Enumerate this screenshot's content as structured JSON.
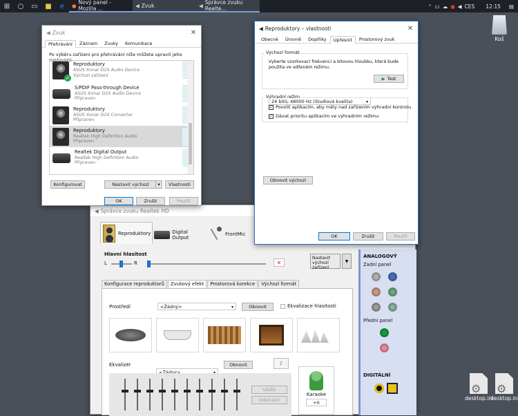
{
  "taskbar": {
    "tasks": [
      {
        "label": "Nový panel - Mozilla ..."
      },
      {
        "label": "Zvuk"
      },
      {
        "label": "Správce zvuku Realte..."
      }
    ],
    "lang": "CES",
    "clock": "12:15"
  },
  "desktop": {
    "recycle_label": "Koš",
    "file1": "desktop.ini",
    "file2": "desktop.ini"
  },
  "zvuk": {
    "title": "Zvuk",
    "tabs": [
      "Přehrávání",
      "Záznam",
      "Zvuky",
      "Komunikace"
    ],
    "instruction": "Po výběru zařízení pro přehrávání níže můžete upravit jeho nastavení:",
    "devices": [
      {
        "name": "Reproduktory",
        "sub1": "ASUS Xonar D2X Audio Device",
        "sub2": "Výchozí zařízení"
      },
      {
        "name": "S/PDIF Pass-through Device",
        "sub1": "ASUS Xonar D2X Audio Device",
        "sub2": "Připraven"
      },
      {
        "name": "Reproduktory",
        "sub1": "ASUS Xonar D2X Converter",
        "sub2": "Připraven"
      },
      {
        "name": "Reproduktory",
        "sub1": "Realtek High Definition Audio",
        "sub2": "Připraven"
      },
      {
        "name": "Realtek Digital Output",
        "sub1": "Realtek High Definition Audio",
        "sub2": "Připraven"
      }
    ],
    "configure": "Konfigurovat",
    "set_default": "Nastavit výchozí",
    "properties": "Vlastnosti",
    "ok": "OK",
    "cancel": "Zrušit",
    "apply": "Použít"
  },
  "props": {
    "title": "Reproduktory – vlastnosti",
    "tabs": [
      "Obecné",
      "Úrovně",
      "Doplňky",
      "Upřesnit",
      "Prostorový zvuk"
    ],
    "default_format_label": "Výchozí formát",
    "default_format_desc": "Vyberte vzorkovací frekvenci a bitovou hloubku, která bude použita ve sdíleném režimu.",
    "format_value": "24 bitů, 48000 Hz (Studiová kvalita)",
    "test": "Test",
    "exclusive_label": "Výhradní režim",
    "check1": "Povolit aplikacím, aby měly nad zařízením výhradní kontrolu",
    "check2": "Dávat prioritu aplikacím ve výhradním režimu",
    "restore": "Obnovit výchozí",
    "ok": "OK",
    "cancel": "Zrušit",
    "apply": "Použít"
  },
  "realtek": {
    "title": "Správce zvuku Realtek HD",
    "main_tabs": [
      "Reproduktory",
      "Digital Output",
      "FrontMic"
    ],
    "volume_label": "Hlavní hlasitost",
    "left": "L",
    "right": "R",
    "set_default_device": "Nastavit výchozí zařízení",
    "sub_tabs": [
      "Konfigurace reproduktorů",
      "Zvukový efekt",
      "Prostorová korekce",
      "Výchozí formát"
    ],
    "env_label": "Prostředí",
    "env_value": "<Žádný>",
    "reset": "Obnovit",
    "loudness": "Ekvalizace hlasitosti",
    "eq_label": "Ekvalizér",
    "eq_value": "<Žádný>",
    "eq_reset": "Obnovit",
    "save": "Uložit",
    "remove": "Odstranit",
    "karaoke": "Karaoke",
    "karaoke_value": "+0",
    "analog": "ANALOGOVÝ",
    "rear_panel": "Zadní panel",
    "front_panel": "Přední panel",
    "digital": "DIGITÁLNÍ",
    "jack_colors": [
      "#b1b1b3",
      "#4b6fb7",
      "#c99a8a",
      "#6aaa84",
      "#9c9c9c",
      "#8ab0a0",
      "#1a9c3a",
      "#e58aa0"
    ]
  }
}
